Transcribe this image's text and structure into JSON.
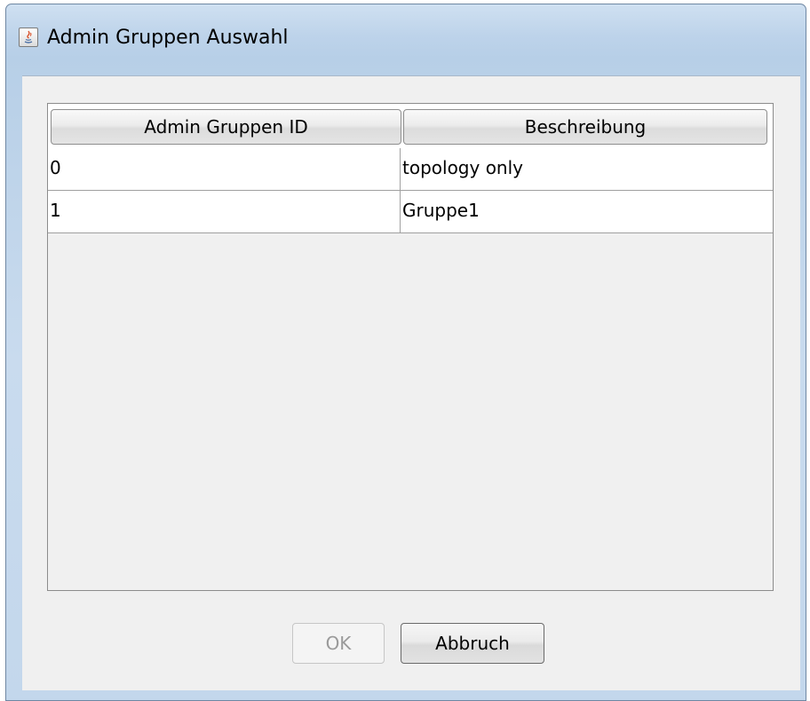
{
  "window": {
    "title": "Admin Gruppen Auswahl",
    "icon": "java-app-icon"
  },
  "table": {
    "columns": [
      "Admin Gruppen ID",
      "Beschreibung"
    ],
    "rows": [
      [
        "0",
        "topology only"
      ],
      [
        "1",
        "Gruppe1"
      ]
    ]
  },
  "buttons": {
    "ok_label": "OK",
    "ok_enabled": false,
    "cancel_label": "Abbruch"
  },
  "colors": {
    "frame": "#bdd3ea",
    "client_background": "#f0f0f0",
    "disabled_text": "#9a9a9a"
  }
}
